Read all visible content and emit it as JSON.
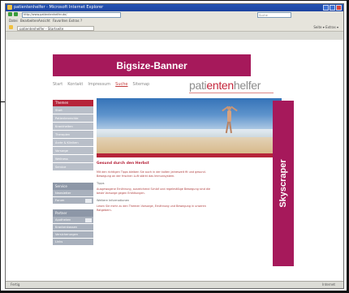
{
  "browser": {
    "window_title": "patientenhelfer - Microsoft Internet Explorer",
    "menu": [
      "Datei",
      "Bearbeiten",
      "Ansicht",
      "Favoriten",
      "Extras",
      "?"
    ],
    "address_value": "http://www.patientenhelfer.de/",
    "search_placeholder": "Suche",
    "tab_title": "patientenhelfer - Startseite",
    "toolbar_right_label": "Seite ▾ Extras ▾",
    "status_text": "Fertig",
    "status_zone": "Internet"
  },
  "ads": {
    "banner_label": "Bigsize-Banner",
    "skyscraper_label": "Skyscraper"
  },
  "site": {
    "topnav": [
      "Start",
      "Kontakt",
      "Impressum",
      "Suche",
      "Sitemap"
    ],
    "topnav_active_index": 3,
    "logo_prefix": "pati",
    "logo_accent": "enten",
    "logo_suffix": "helfer",
    "sidebar_head": "Themen",
    "sidebar_items": [
      "Start",
      "Patientenrechte",
      "Krankheiten",
      "Therapien",
      "Ärzte & Kliniken",
      "Vorsorge",
      "Wellness",
      "Service"
    ],
    "sidebar_head2": "Service",
    "sidebar_items2": [
      "Newsletter",
      "Forum"
    ],
    "sidebar_head3": "Partner",
    "sidebar_items3": [
      "Apotheken",
      "Krankenkassen",
      "Versicherungen",
      "Links"
    ],
    "content_heading": "Gesund durch den Herbst",
    "content_para1": "Mit den richtigen Tipps bleiben Sie auch in der kalten Jahreszeit fit und gesund. Bewegung an der frischen Luft stärkt das Immunsystem.",
    "content_sub1": "Tipps",
    "content_para2": "Ausgewogene Ernährung, ausreichend Schlaf und regelmäßige Bewegung sind die beste Vorsorge gegen Erkältungen.",
    "content_sub2": "Weitere Informationen",
    "content_para3": "Lesen Sie mehr zu den Themen Vorsorge, Ernährung und Bewegung in unseren Ratgebern."
  }
}
